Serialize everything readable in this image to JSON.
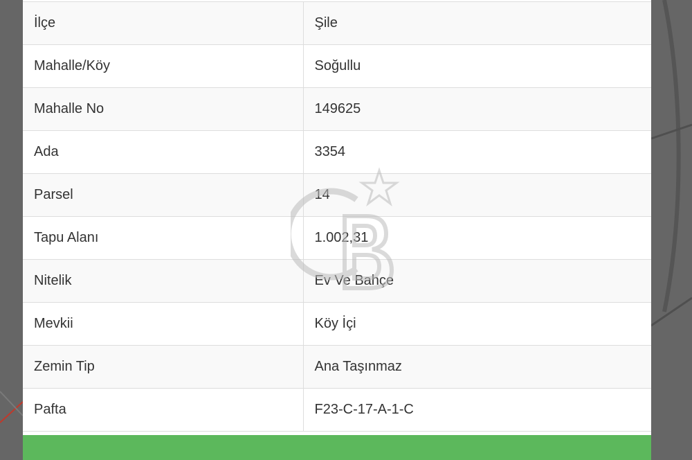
{
  "parcel_table": {
    "rows": [
      {
        "label": "İlçe",
        "value": "Şile"
      },
      {
        "label": "Mahalle/Köy",
        "value": "Soğullu"
      },
      {
        "label": "Mahalle No",
        "value": "149625"
      },
      {
        "label": "Ada",
        "value": "3354"
      },
      {
        "label": "Parsel",
        "value": "14"
      },
      {
        "label": "Tapu Alanı",
        "value": "1.002,31"
      },
      {
        "label": "Nitelik",
        "value": "Ev Ve Bahçe"
      },
      {
        "label": "Mevkii",
        "value": "Köy İçi"
      },
      {
        "label": "Zemin Tip",
        "value": "Ana Taşınmaz"
      },
      {
        "label": "Pafta",
        "value": "F23-C-17-A-1-C"
      }
    ]
  },
  "action_button": {
    "label": ""
  },
  "colors": {
    "button_green": "#5cb85c",
    "background_map": "#666666",
    "border": "#dddddd",
    "text": "#333333"
  },
  "icons": {
    "watermark": "cb-star-logo-watermark"
  }
}
